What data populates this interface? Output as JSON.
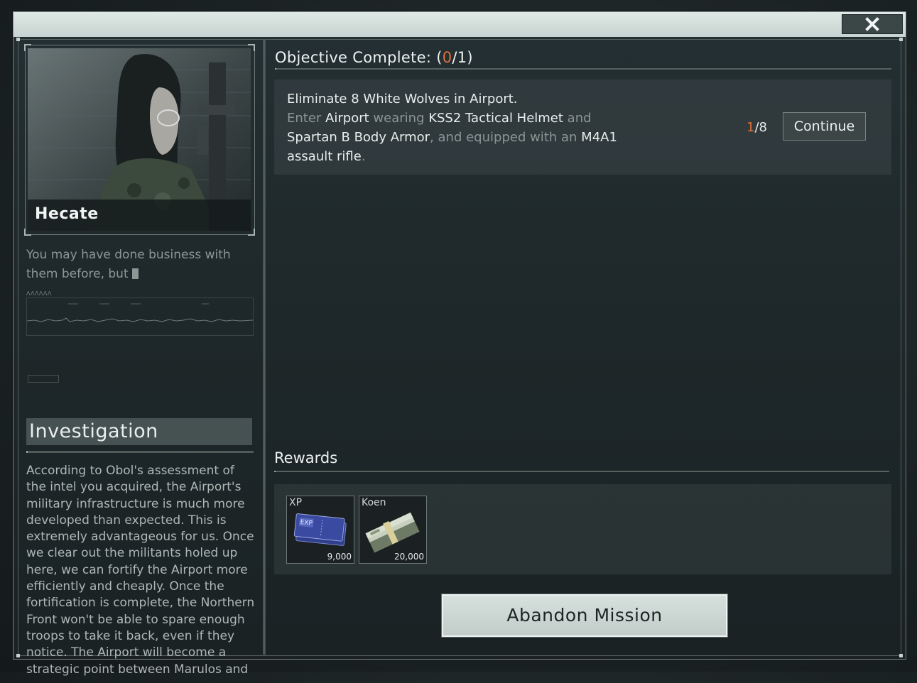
{
  "window": {
    "close_icon": "close-icon"
  },
  "character": {
    "name": "Hecate",
    "tagline": "You may have done business with them before, but"
  },
  "investigation": {
    "heading": "Investigation",
    "text": "According to Obol's assessment of the intel you acquired, the Airport's military infrastructure is much more developed than expected. This is extremely advantageous for us. Once we clear out the militants holed up here, we can fortify the Airport more efficiently and cheaply. Once the fortification is complete, the Northern Front won't be able to spare enough troops to take it back, even if they notice. The Airport will become a strategic point between Marulos and"
  },
  "objective": {
    "title_prefix": "Objective Complete: (",
    "completed": "0",
    "title_suffix": "/1)",
    "line1_a": "Eliminate 8 ",
    "line1_b": "White Wolves",
    "line1_c": " in ",
    "line1_d": "Airport",
    "line1_e": ".",
    "cond_enter": "Enter ",
    "cond_airport": "Airport",
    "cond_wearing": " wearing ",
    "cond_helmet": "KSS2 Tactical Helmet",
    "cond_and": " and",
    "cond_armor": "Spartan B Body Armor",
    "cond_equipped": ", and equipped with an ",
    "cond_gun": "M4A1 assault rifle",
    "cond_end": ".",
    "progress_current": "1",
    "progress_total": "/8",
    "continue_label": "Continue"
  },
  "rewards": {
    "title": "Rewards",
    "items": [
      {
        "label": "XP",
        "amount": "9,000",
        "icon": "exp-ticket-icon"
      },
      {
        "label": "Koen",
        "amount": "20,000",
        "icon": "cash-stack-icon"
      }
    ]
  },
  "abandon_label": "Abandon Mission",
  "colors": {
    "accent_orange": "#e1703b",
    "titlebar": "#d3dedb",
    "panel": "#1e2729"
  }
}
